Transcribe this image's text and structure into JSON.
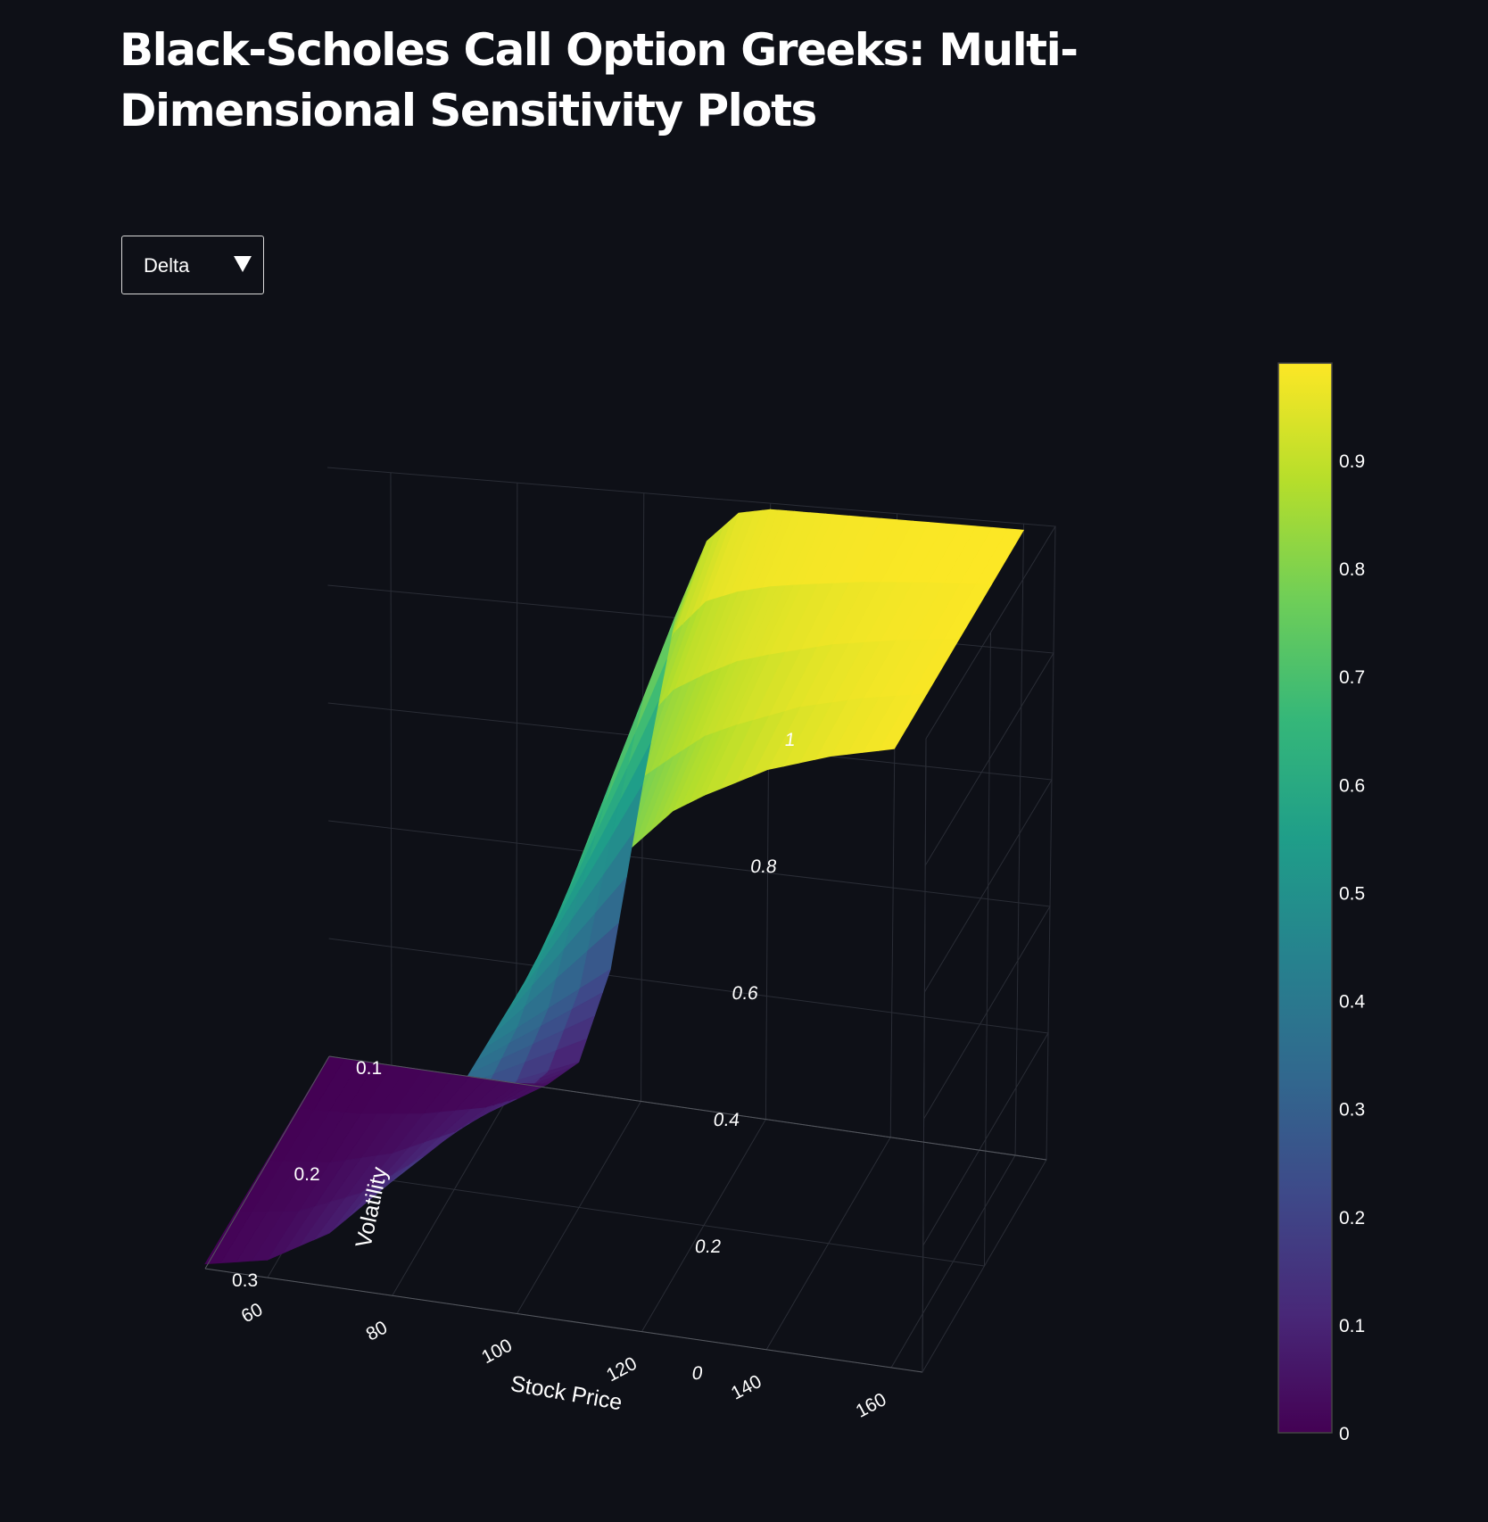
{
  "title": "Black-Scholes Call Option Greeks: Multi-Dimensional Sensitivity Plots",
  "dropdown": {
    "selected": "Delta",
    "icon": "triangle-down-icon"
  },
  "colors": {
    "background": "#0e1017",
    "grid": "#2a2d36",
    "axis_line": "#55585f",
    "text": "#ffffff",
    "colorscale": [
      "#440154",
      "#482878",
      "#3e4989",
      "#31688e",
      "#26828e",
      "#1f9e89",
      "#35b779",
      "#6ece58",
      "#b5de2b",
      "#fde725"
    ]
  },
  "chart_data": {
    "type": "surface",
    "greek": "Delta",
    "x_label": "Stock Price",
    "y_label": "Volatility",
    "x_ticks": [
      160,
      140,
      120,
      100,
      80,
      60
    ],
    "y_ticks": [
      0.1,
      0.2,
      0.3
    ],
    "z_ticks": [
      "0",
      "0.2",
      "0.4",
      "0.6",
      "0.8",
      "1"
    ],
    "x_range": [
      50,
      165
    ],
    "y_range": [
      0.1,
      0.3
    ],
    "z_range": [
      0,
      1
    ],
    "colorbar_ticks": [
      "0",
      "0.1",
      "0.2",
      "0.3",
      "0.4",
      "0.5",
      "0.6",
      "0.7",
      "0.8",
      "0.9"
    ],
    "colorbar_range": [
      0,
      0.99
    ],
    "surface": {
      "stock_price": [
        50,
        60,
        70,
        80,
        85,
        90,
        95,
        100,
        105,
        110,
        115,
        120,
        125,
        130,
        140,
        150,
        160
      ],
      "volatility": [
        0.1,
        0.15,
        0.2,
        0.25,
        0.3
      ],
      "delta_at_vol_0_1": [
        0.0,
        0.0,
        0.0,
        0.0,
        0.006,
        0.05,
        0.21,
        0.52,
        0.8,
        0.93,
        0.98,
        0.99,
        0.99,
        0.99,
        0.99,
        0.99,
        0.99
      ],
      "delta_at_vol_0_3": [
        0.008,
        0.03,
        0.09,
        0.19,
        0.26,
        0.34,
        0.43,
        0.52,
        0.61,
        0.68,
        0.75,
        0.8,
        0.85,
        0.88,
        0.93,
        0.96,
        0.98
      ]
    }
  }
}
